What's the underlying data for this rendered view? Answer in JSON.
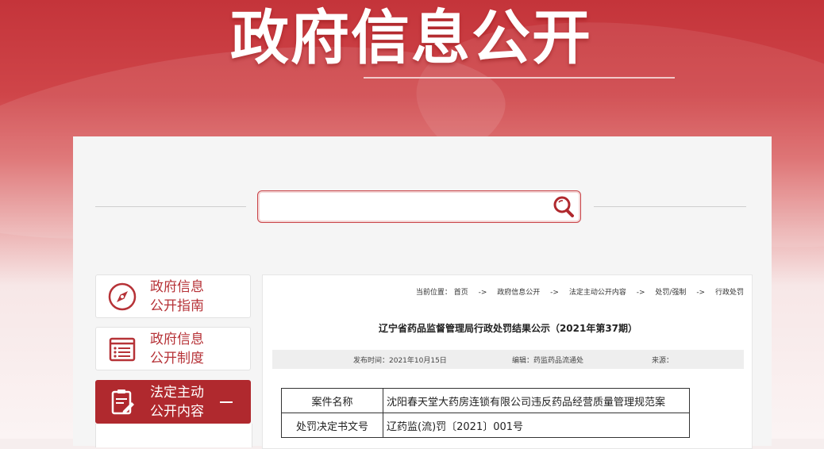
{
  "banner": {
    "title": "政府信息公开"
  },
  "search": {
    "value": "",
    "placeholder": ""
  },
  "sidebar": {
    "items": [
      {
        "line1": "政府信息",
        "line2": "公开指南",
        "icon": "compass-icon"
      },
      {
        "line1": "政府信息",
        "line2": "公开制度",
        "icon": "list-icon"
      },
      {
        "line1": "法定主动",
        "line2": "公开内容",
        "icon": "document-edit-icon"
      }
    ]
  },
  "breadcrumb": {
    "prefix": "当前位置：",
    "items": [
      "首页",
      "政府信息公开",
      "法定主动公开内容",
      "处罚/强制",
      "行政处罚"
    ],
    "separator": "->"
  },
  "article": {
    "title": "辽宁省药品监督管理局行政处罚结果公示（2021年第37期）",
    "publish_time": "发布时间：2021年10月15日",
    "editor": "编辑：药监药品流通处",
    "source": "来源："
  },
  "table": {
    "rows": [
      {
        "key": "案件名称",
        "value": "沈阳春天堂大药房连锁有限公司违反药品经营质量管理规范案"
      },
      {
        "key": "处罚决定书文号",
        "value": "辽药监(流)罚〔2021〕001号"
      }
    ]
  },
  "colors": {
    "brand_red": "#b0292e",
    "banner_red": "#c4343a"
  }
}
